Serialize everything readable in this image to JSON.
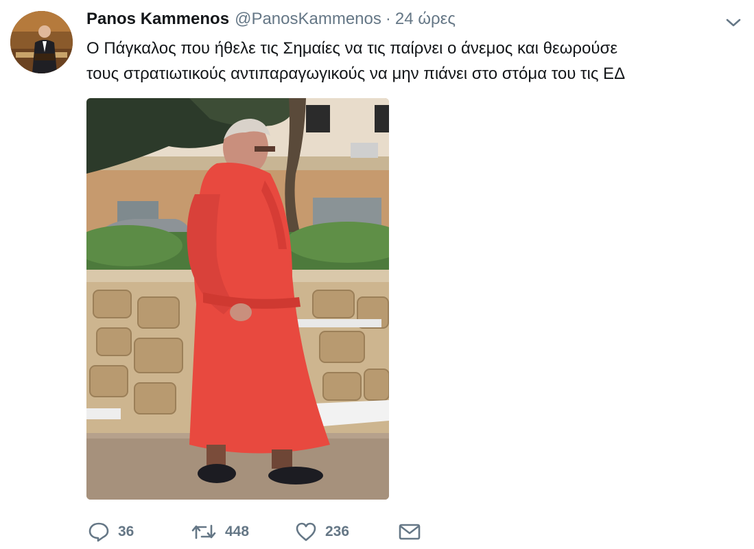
{
  "user": {
    "name": "Panos Kammenos",
    "handle": "@PanosKammenos",
    "separator": "·",
    "time": "24 ώρες"
  },
  "tweet": {
    "lines": [
      "Ο Πάγκαλος που ήθελε τις Σημαίες να τις παίρνει ο άνεμος και θεωρούσε",
      "τους στρατιωτικούς αντιπαραγωγικούς να μην πιάνει στο στόμα του τις ΕΔ"
    ]
  },
  "actions": {
    "replies": "36",
    "retweets": "448",
    "likes": "236"
  },
  "icons": {
    "reply": "reply-icon",
    "retweet": "retweet-icon",
    "like": "heart-icon",
    "dm": "envelope-icon",
    "menu": "chevron-down-icon"
  },
  "colors": {
    "text": "#14171a",
    "muted": "#657786",
    "robe": "#e8493f"
  }
}
